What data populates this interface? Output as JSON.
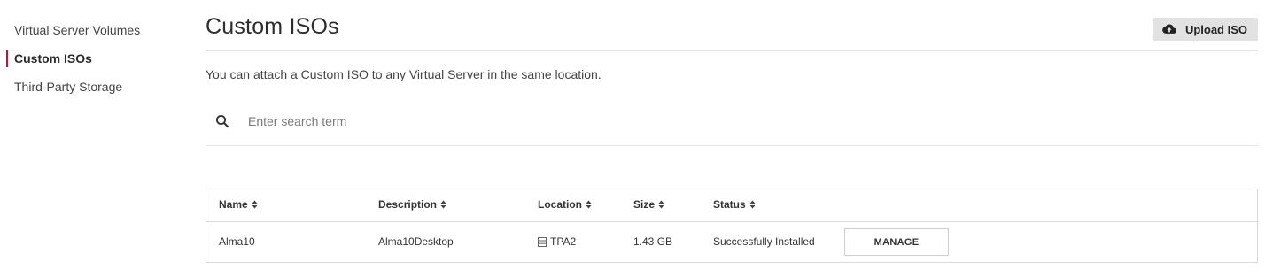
{
  "sidebar": {
    "items": [
      {
        "label": "Virtual Server Volumes",
        "active": false
      },
      {
        "label": "Custom ISOs",
        "active": true
      },
      {
        "label": "Third-Party Storage",
        "active": false
      }
    ]
  },
  "header": {
    "title": "Custom ISOs",
    "upload_button": {
      "label": "Upload ISO",
      "icon": "cloud-upload-icon"
    }
  },
  "description": "You can attach a Custom ISO to any Virtual Server in the same location.",
  "search": {
    "placeholder": "Enter search term",
    "value": "",
    "icon": "search-icon"
  },
  "table": {
    "columns": [
      "Name",
      "Description",
      "Location",
      "Size",
      "Status"
    ],
    "rows": [
      {
        "name": "Alma10",
        "description": "Alma10Desktop",
        "location": "TPA2",
        "location_icon": "server-icon",
        "size": "1.43 GB",
        "status": "Successfully Installed",
        "action_label": "MANAGE"
      }
    ]
  },
  "colors": {
    "accent": "#c8102e",
    "button_bg": "#e2e2e2",
    "border": "#d9d9d9"
  }
}
